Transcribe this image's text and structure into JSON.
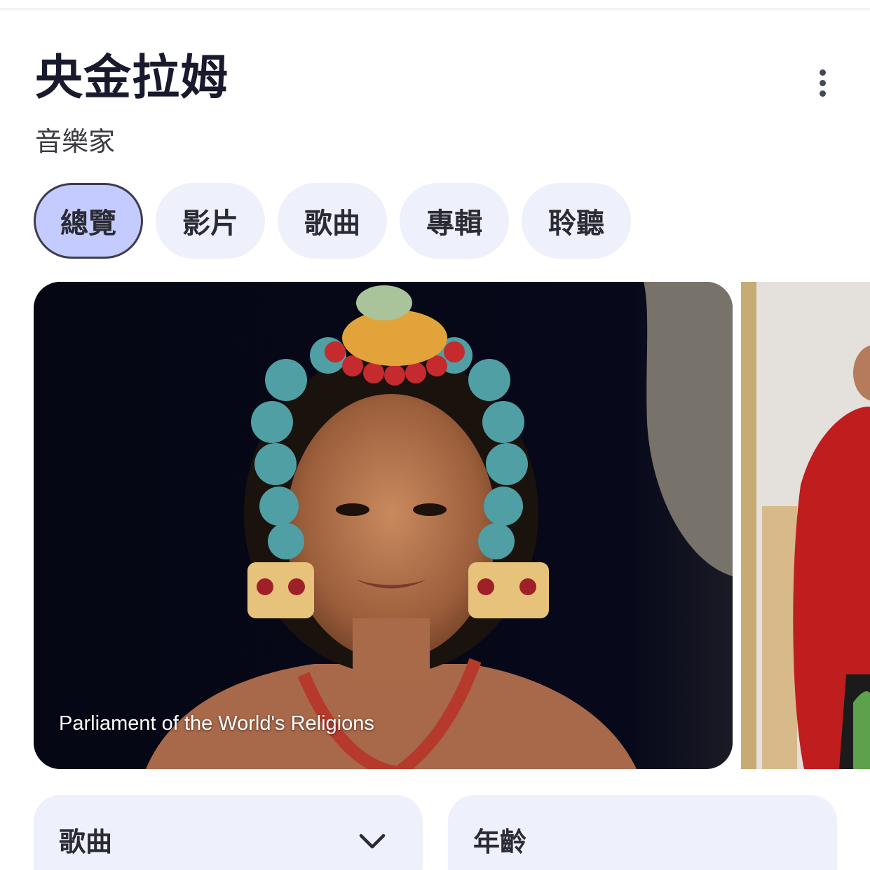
{
  "entity": {
    "title": "央金拉姆",
    "subtitle": "音樂家"
  },
  "menu": {
    "icon": "more-vert-icon"
  },
  "tabs": [
    {
      "label": "總覽",
      "active": true
    },
    {
      "label": "影片",
      "active": false
    },
    {
      "label": "歌曲",
      "active": false
    },
    {
      "label": "專輯",
      "active": false
    },
    {
      "label": "聆聽",
      "active": false
    }
  ],
  "images": [
    {
      "caption": "Parliament of the World's Religions"
    }
  ],
  "cards": {
    "songs": {
      "title": "歌曲",
      "icon": "chevron-down-icon"
    },
    "age": {
      "title": "年齡"
    }
  },
  "colors": {
    "accent_tab": "#c4cbff",
    "chip_bg": "#eef0fb",
    "text": "#1a1a2e"
  }
}
